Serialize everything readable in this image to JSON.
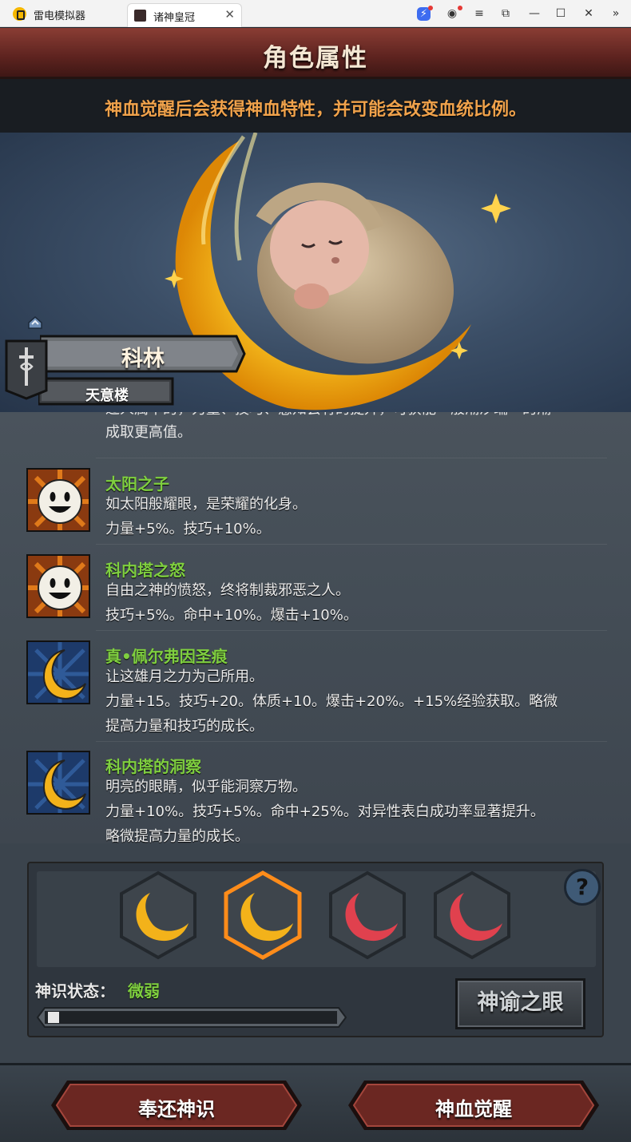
{
  "emulator": {
    "app_name": "雷电模拟器",
    "tab_title": "诸神皇冠",
    "tab_close": "✕",
    "controls": {
      "boost": "⚡",
      "user": "◉",
      "menu": "≡",
      "popout": "⧉",
      "minimize": "—",
      "maximize": "☐",
      "close": "✕",
      "more": "»"
    }
  },
  "header": {
    "title": "角色属性"
  },
  "banner": {
    "text": "神血觉醒后会获得神血特性，并可能会改变血统比例。"
  },
  "character": {
    "name": "科林",
    "subtitle": "天意楼"
  },
  "list": {
    "clipped_top_line1": "过人属中的，力量、技巧、感知会有的提升，可获能一般潮汐端一的潮",
    "clipped_top_line2": "成取更高值。",
    "traits": [
      {
        "name": "太阳之子",
        "desc1": "如太阳般耀眼，是荣耀的化身。",
        "desc2": "力量+5%。技巧+10%。",
        "icon": "sun-face-icon"
      },
      {
        "name": "科内塔之怒",
        "desc1": "自由之神的愤怒，终将制裁邪恶之人。",
        "desc2": "技巧+5%。命中+10%。爆击+10%。",
        "icon": "sun-face-icon"
      },
      {
        "name": "真•佩尔弗因圣痕",
        "desc1": "让这雄月之力为己所用。",
        "desc2": "力量+15。技巧+20。体质+10。爆击+20%。+15%经验获取。略微",
        "desc3": "提高力量和技巧的成长。",
        "icon": "crescent-moon-icon"
      },
      {
        "name": "科内塔的洞察",
        "desc1": "明亮的眼睛，似乎能洞察万物。",
        "desc2": "力量+10%。技巧+5%。命中+25%。对异性表白成功率显著提升。",
        "desc3": "略微提高力量的成长。",
        "icon": "crescent-moon-icon"
      }
    ]
  },
  "panel": {
    "help": "?",
    "status_label": "神识状态：",
    "status_value": "微弱",
    "progress_fraction": 0.04,
    "oracle_button": "神谕之眼",
    "slots": [
      {
        "color": "gold",
        "selected": false
      },
      {
        "color": "gold",
        "selected": true
      },
      {
        "color": "red",
        "selected": false
      },
      {
        "color": "red",
        "selected": false
      }
    ]
  },
  "buttons": {
    "return": "奉还神识",
    "awaken": "神血觉醒"
  },
  "colors": {
    "trait_name": "#7fcf3f",
    "banner_text": "#f0a24b",
    "header_bg": "#5d231f",
    "gold": "#f3b21a",
    "red": "#e0414e"
  }
}
